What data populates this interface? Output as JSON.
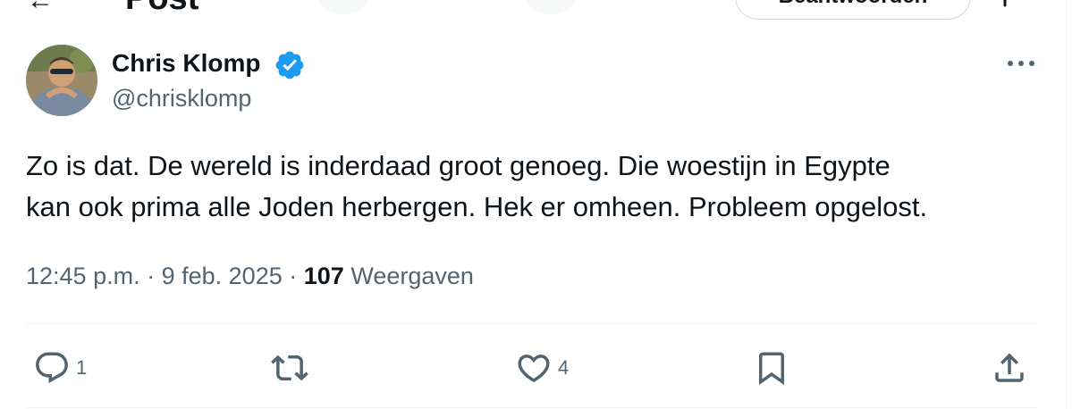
{
  "header": {
    "back_icon": "arrow-left-icon",
    "title": "Post",
    "reply_button_label": "Beantwoorden"
  },
  "author": {
    "name": "Chris Klomp",
    "handle": "@chrisklomp",
    "verified": true,
    "verified_color": "#1d9bf0"
  },
  "tweet": {
    "lines": [
      "Zo is dat. De wereld is inderdaad groot genoeg. Die woestijn in Egypte",
      "kan ook prima alle Joden herbergen. Hek er omheen. Probleem opgelost."
    ]
  },
  "meta": {
    "time": "12:45 p.m.",
    "separator": "·",
    "date": "9 feb. 2025",
    "views_count": "107",
    "views_label": "Weergaven"
  },
  "actions": {
    "reply_count": "1",
    "retweet_count": "",
    "like_count": "4"
  },
  "colors": {
    "text_primary": "#0f1419",
    "text_secondary": "#536471",
    "divider": "#eff3f4",
    "accent": "#1d9bf0"
  }
}
